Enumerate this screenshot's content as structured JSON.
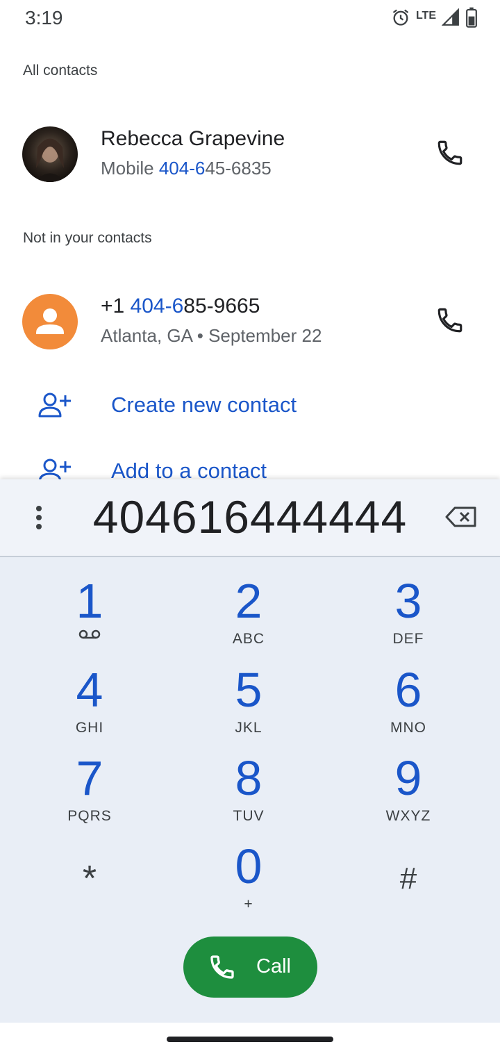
{
  "status_bar": {
    "time": "3:19",
    "network": "LTE",
    "icons": [
      "alarm-icon",
      "signal-icon",
      "battery-icon"
    ]
  },
  "sections": {
    "all_contacts": "All contacts",
    "not_in_contacts": "Not in your contacts"
  },
  "contacts": [
    {
      "name": "Rebecca Grapevine",
      "label": "Mobile",
      "number_match": "404-6",
      "number_rest": "45-6835",
      "avatar": "photo"
    }
  ],
  "unknown": {
    "prefix": "+1 ",
    "number_match": "404-6",
    "number_rest": "85-9665",
    "details": "Atlanta, GA • September 22",
    "avatar": "person-icon"
  },
  "actions": {
    "create_contact": "Create new contact",
    "add_to_contact": "Add to a contact"
  },
  "dialer": {
    "digits": "404616444444",
    "keys": [
      {
        "digit": "1",
        "letters": ""
      },
      {
        "digit": "2",
        "letters": "ABC"
      },
      {
        "digit": "3",
        "letters": "DEF"
      },
      {
        "digit": "4",
        "letters": "GHI"
      },
      {
        "digit": "5",
        "letters": "JKL"
      },
      {
        "digit": "6",
        "letters": "MNO"
      },
      {
        "digit": "7",
        "letters": "PQRS"
      },
      {
        "digit": "8",
        "letters": "TUV"
      },
      {
        "digit": "9",
        "letters": "WXYZ"
      },
      {
        "digit": "*",
        "letters": ""
      },
      {
        "digit": "0",
        "letters": "+"
      },
      {
        "digit": "#",
        "letters": ""
      }
    ],
    "call_label": "Call"
  },
  "colors": {
    "accent": "#1a56c9",
    "call_green": "#1e8e3e",
    "dialpad_bg": "#e9eef6",
    "avatar_orange": "#f28b3a"
  }
}
